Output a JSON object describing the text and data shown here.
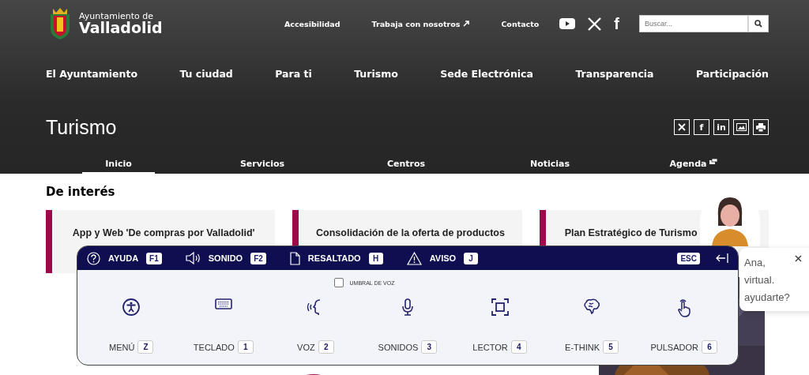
{
  "header": {
    "logo": {
      "line1": "Ayuntamiento de",
      "line2": "Valladolid"
    },
    "links": [
      {
        "label": "Accesibilidad",
        "external": false
      },
      {
        "label": "Trabaja con nosotros",
        "external": true
      },
      {
        "label": "Contacto",
        "external": false
      }
    ],
    "social": [
      "f"
    ],
    "search": {
      "placeholder": "Buscar..."
    }
  },
  "main_nav": [
    "El Ayuntamiento",
    "Tu ciudad",
    "Para ti",
    "Turismo",
    "Sede Electrónica",
    "Transparencia",
    "Participación"
  ],
  "section": {
    "title": "Turismo",
    "share": [
      "f",
      "in"
    ],
    "subnav": [
      {
        "label": "Inicio",
        "selected": true,
        "external": false
      },
      {
        "label": "Servicios",
        "selected": false,
        "external": false
      },
      {
        "label": "Centros",
        "selected": false,
        "external": false
      },
      {
        "label": "Noticias",
        "selected": false,
        "external": false
      },
      {
        "label": "Agenda",
        "selected": false,
        "external": true
      }
    ]
  },
  "interest": {
    "heading": "De interés",
    "cards": [
      {
        "title": "App y Web 'De compras por Valladolid'"
      },
      {
        "title": "Consolidación de la oferta de productos"
      },
      {
        "title": "Plan Estratégico de Turismo"
      }
    ]
  },
  "accessibility_panel": {
    "top": [
      {
        "label": "AYUDA",
        "key": "F1"
      },
      {
        "label": "SONIDO",
        "key": "F2"
      },
      {
        "label": "RESALTADO",
        "key": "H"
      },
      {
        "label": "AVISO",
        "key": "J"
      }
    ],
    "close_key": "ESC",
    "voice_threshold": {
      "label": "UMBRAL DE VOZ",
      "checked": false
    },
    "tools": [
      {
        "label": "MENÚ",
        "key": "Z"
      },
      {
        "label": "TECLADO",
        "key": "1"
      },
      {
        "label": "VOZ",
        "key": "2"
      },
      {
        "label": "SONIDOS",
        "key": "3"
      },
      {
        "label": "LECTOR",
        "key": "4"
      },
      {
        "label": "E-THINK",
        "key": "5"
      },
      {
        "label": "PULSADOR",
        "key": "6"
      }
    ]
  },
  "assistant": {
    "lines": [
      "Ana,",
      "virtual.",
      "ayudarte?"
    ]
  }
}
